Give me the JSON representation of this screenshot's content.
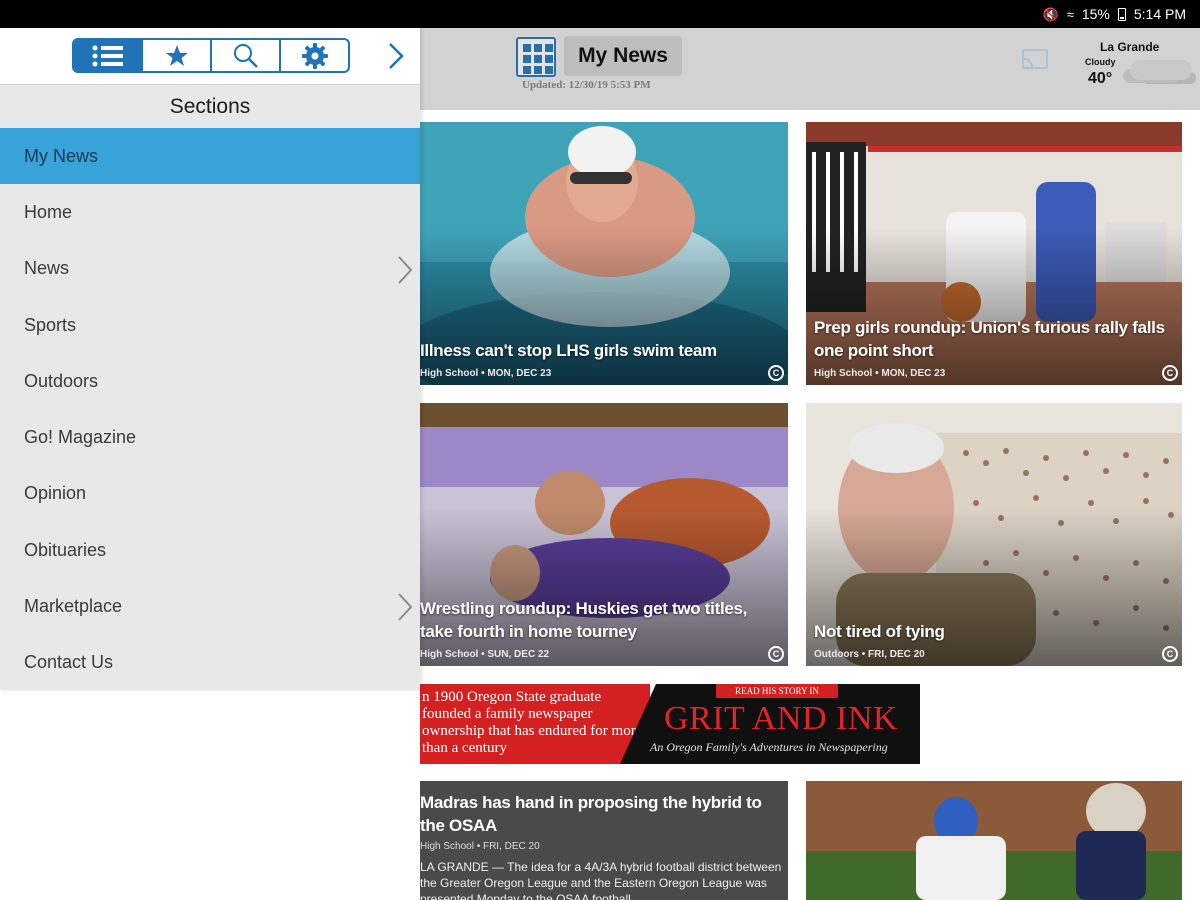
{
  "status_bar": {
    "battery": "15%",
    "time": "5:14 PM",
    "icons": [
      "mute-icon",
      "wifi-icon",
      "battery-icon"
    ]
  },
  "header": {
    "title": "My News",
    "updated": "Updated: 12/30/19 5:53 PM",
    "weather": {
      "city": "La Grande",
      "condition": "Cloudy",
      "temperature": "40°"
    }
  },
  "sidebar": {
    "toolbar_icons": [
      "list-icon",
      "star-icon",
      "search-icon",
      "gear-icon"
    ],
    "sections_title": "Sections",
    "items": [
      {
        "label": "My News",
        "active": true,
        "has_submenu": false
      },
      {
        "label": "Home",
        "active": false,
        "has_submenu": false
      },
      {
        "label": "News",
        "active": false,
        "has_submenu": true
      },
      {
        "label": "Sports",
        "active": false,
        "has_submenu": false
      },
      {
        "label": "Outdoors",
        "active": false,
        "has_submenu": false
      },
      {
        "label": "Go! Magazine",
        "active": false,
        "has_submenu": false
      },
      {
        "label": "Opinion",
        "active": false,
        "has_submenu": false
      },
      {
        "label": "Obituaries",
        "active": false,
        "has_submenu": false
      },
      {
        "label": "Marketplace",
        "active": false,
        "has_submenu": true
      },
      {
        "label": "Contact Us",
        "active": false,
        "has_submenu": false
      }
    ]
  },
  "stories": [
    {
      "headline": "Illness can't stop LHS girls swim team",
      "meta": "High School • MON, DEC 23"
    },
    {
      "headline": "Prep girls roundup: Union's furious rally falls one point short",
      "meta": "High School • MON, DEC 23"
    },
    {
      "headline": "Wrestling roundup: Huskies get two titles, take fourth in home tourney",
      "meta": "High School • SUN, DEC 22"
    },
    {
      "headline": "Not tired of tying",
      "meta": "Outdoors • FRI, DEC 20"
    }
  ],
  "ad": {
    "left_text": "n 1900 Oregon State graduate founded a family newspaper ownership that has endured for more than a century",
    "read_tag": "READ HIS STORY IN",
    "title": "GRIT AND INK",
    "subtitle": "An Oregon Family's Adventures in Newspapering"
  },
  "text_story": {
    "headline": "Madras has hand in proposing the hybrid to the OSAA",
    "meta": "High School • FRI, DEC 20",
    "excerpt": "LA GRANDE — The idea for a 4A/3A hybrid football district between the Greater Oregon League and the Eastern Oregon League was presented Monday to the OSAA football"
  },
  "colors": {
    "accent": "#1f73b6",
    "active_menu": "#37a3d9",
    "header_bg": "#d2d2d2",
    "sidebar_bg": "#e8e8e8",
    "ad_red": "#d42020"
  }
}
